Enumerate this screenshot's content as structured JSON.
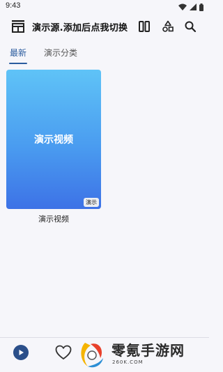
{
  "status_bar": {
    "time": "9:43",
    "icons": [
      "wifi-icon",
      "signal-icon",
      "battery-icon"
    ]
  },
  "app_bar": {
    "source_icon": "video-source-icon",
    "title": "演示源.添加后点我切换",
    "actions": [
      "layout-icon",
      "shapes-filter-icon",
      "search-icon"
    ]
  },
  "tabs": [
    {
      "label": "最新",
      "active": true
    },
    {
      "label": "演示分类",
      "active": false
    }
  ],
  "videos": [
    {
      "cover_title": "演示视频",
      "badge": "演示",
      "caption": "演示视频"
    }
  ],
  "bottom_nav": {
    "icons": [
      "play-icon",
      "heart-icon"
    ]
  },
  "watermark": {
    "title": "零氪手游网",
    "domain": "260K.COM"
  },
  "colors": {
    "accent": "#2b5c9e",
    "card_gradient_top": "#5fc3f7",
    "card_gradient_bottom": "#3d72e6",
    "background": "#f6f6fa"
  }
}
